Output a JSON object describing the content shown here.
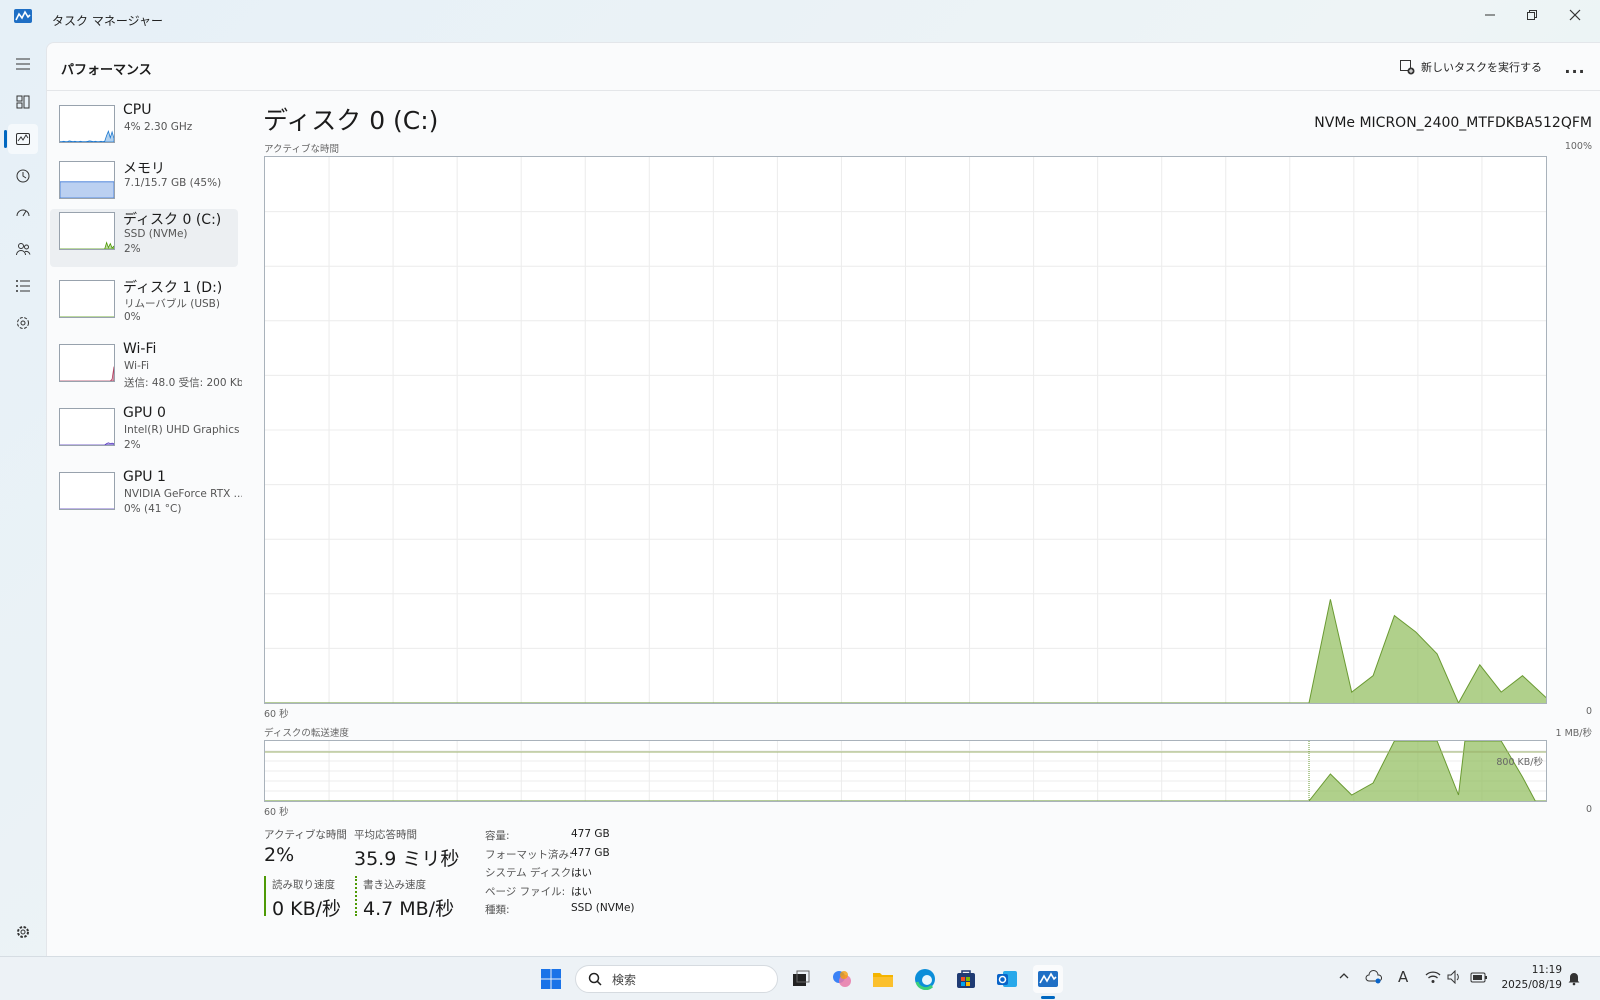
{
  "window": {
    "title": "タスク マネージャー"
  },
  "header": {
    "title": "パフォーマンス",
    "new_task_label": "新しいタスクを実行する",
    "more_label": "..."
  },
  "devices": [
    {
      "name": "CPU",
      "line1": "4%  2.30 GHz",
      "line2": "",
      "color": "#1f7ad1",
      "values": [
        1,
        1,
        2,
        1,
        1,
        3,
        2,
        1,
        2,
        1,
        1,
        2,
        1,
        1,
        1,
        2,
        3,
        2,
        1,
        2,
        1,
        1,
        2,
        1,
        2,
        18,
        30,
        12,
        28,
        10
      ]
    },
    {
      "name": "メモリ",
      "line1": "7.1/15.7 GB (45%)",
      "line2": "",
      "color": "#3c78d8",
      "values": [
        45,
        45,
        45,
        45,
        45,
        45,
        45,
        45,
        45,
        45,
        45,
        45,
        45,
        45,
        45,
        45,
        45,
        45,
        45,
        45,
        45,
        45,
        45,
        45,
        45,
        45,
        45,
        45,
        45,
        45
      ]
    },
    {
      "name": "ディスク 0 (C:)",
      "line1": "SSD (NVMe)",
      "line2": "2%",
      "color": "#4e9a06",
      "values": [
        0,
        0,
        0,
        0,
        0,
        0,
        0,
        0,
        0,
        0,
        0,
        0,
        0,
        0,
        0,
        0,
        0,
        0,
        0,
        0,
        0,
        0,
        0,
        0,
        0,
        18,
        4,
        15,
        3,
        8
      ]
    },
    {
      "name": "ディスク 1 (D:)",
      "line1": "リムーバブル (USB)",
      "line2": "0%",
      "color": "#4e9a06",
      "values": [
        0,
        0,
        0,
        0,
        0,
        0,
        0,
        0,
        0,
        0,
        0,
        0,
        0,
        0,
        0,
        0,
        0,
        0,
        0,
        0,
        0,
        0,
        0,
        0,
        0,
        0,
        0,
        0,
        0,
        0
      ]
    },
    {
      "name": "Wi-Fi",
      "line1": "Wi-Fi",
      "line2": "送信: 48.0  受信: 200 Kb",
      "color": "#b04060",
      "values": [
        0,
        0,
        0,
        0,
        0,
        0,
        0,
        0,
        0,
        0,
        0,
        0,
        0,
        0,
        0,
        0,
        0,
        0,
        0,
        0,
        0,
        0,
        0,
        0,
        0,
        0,
        0,
        0,
        5,
        40
      ]
    },
    {
      "name": "GPU 0",
      "line1": "Intel(R) UHD Graphics",
      "line2": "2%",
      "color": "#5a3fc0",
      "values": [
        0,
        0,
        0,
        0,
        0,
        0,
        0,
        0,
        0,
        0,
        0,
        0,
        0,
        0,
        0,
        0,
        0,
        0,
        0,
        0,
        0,
        0,
        0,
        0,
        0,
        4,
        6,
        4,
        5,
        4
      ]
    },
    {
      "name": "GPU 1",
      "line1": "NVIDIA GeForce RTX ...",
      "line2": "0% (41 °C)",
      "color": "#5a3fc0",
      "values": [
        0,
        0,
        0,
        0,
        0,
        0,
        0,
        0,
        0,
        0,
        0,
        0,
        0,
        0,
        0,
        0,
        0,
        0,
        0,
        0,
        0,
        0,
        0,
        0,
        0,
        0,
        0,
        0,
        0,
        0
      ]
    }
  ],
  "detail": {
    "title": "ディスク 0 (C:)",
    "model": "NVMe MICRON_2400_MTFDKBA512QFM",
    "active_time_label": "アクティブな時間",
    "active_time_max": "100%",
    "x_left_label": "60 秒",
    "x_right_label": "0",
    "transfer_label": "ディスクの転送速度",
    "transfer_max": "1 MB/秒",
    "transfer_mid": "800 KB/秒",
    "x2_left_label": "60 秒",
    "x2_right_label": "0"
  },
  "chart_data": [
    {
      "type": "area",
      "title": "アクティブな時間",
      "x_range_label": [
        "60 秒",
        "0"
      ],
      "ylim": [
        0,
        100
      ],
      "color": "#8fbc5a",
      "points": [
        {
          "x": 60,
          "y": 0
        },
        {
          "x": 11.1,
          "y": 0
        },
        {
          "x": 10.1,
          "y": 19
        },
        {
          "x": 9.1,
          "y": 2
        },
        {
          "x": 8.1,
          "y": 5
        },
        {
          "x": 7.1,
          "y": 16
        },
        {
          "x": 6.1,
          "y": 13
        },
        {
          "x": 5.1,
          "y": 9
        },
        {
          "x": 4.1,
          "y": 0
        },
        {
          "x": 3.1,
          "y": 7
        },
        {
          "x": 2.1,
          "y": 2
        },
        {
          "x": 1.1,
          "y": 5
        },
        {
          "x": 0,
          "y": 1
        }
      ]
    },
    {
      "type": "area",
      "title": "ディスクの転送速度",
      "x_range_label": [
        "60 秒",
        "0"
      ],
      "ylim": [
        0,
        1
      ],
      "y_unit": "MB/秒",
      "color": "#8fbc5a",
      "points": [
        {
          "x": 60,
          "y": 0
        },
        {
          "x": 11.1,
          "y": 0
        },
        {
          "x": 10.1,
          "y": 0.45
        },
        {
          "x": 9.1,
          "y": 0.1
        },
        {
          "x": 8.1,
          "y": 0.3
        },
        {
          "x": 7.1,
          "y": 1.0
        },
        {
          "x": 6.1,
          "y": 1.0
        },
        {
          "x": 5.1,
          "y": 1.0
        },
        {
          "x": 4.1,
          "y": 0.1
        },
        {
          "x": 3.8,
          "y": 1.0
        },
        {
          "x": 2.1,
          "y": 1.0
        },
        {
          "x": 1.1,
          "y": 0.4
        },
        {
          "x": 0.5,
          "y": 0
        },
        {
          "x": 0,
          "y": 0
        }
      ]
    }
  ],
  "stats": {
    "active_time_label": "アクティブな時間",
    "active_time_value": "2%",
    "avg_response_label": "平均応答時間",
    "avg_response_value": "35.9 ミリ秒",
    "read_label": "読み取り速度",
    "read_value": "0 KB/秒",
    "write_label": "書き込み速度",
    "write_value": "4.7 MB/秒"
  },
  "properties": [
    {
      "key": "容量:",
      "value": "477 GB"
    },
    {
      "key": "フォーマット済み:",
      "value": "477 GB"
    },
    {
      "key": "システム ディスク:",
      "value": "はい"
    },
    {
      "key": "ページ ファイル:",
      "value": "はい"
    },
    {
      "key": "種類:",
      "value": "SSD (NVMe)"
    }
  ],
  "taskbar": {
    "search_placeholder": "検索",
    "ime": "A",
    "time": "11:19",
    "date": "2025/08/19"
  }
}
